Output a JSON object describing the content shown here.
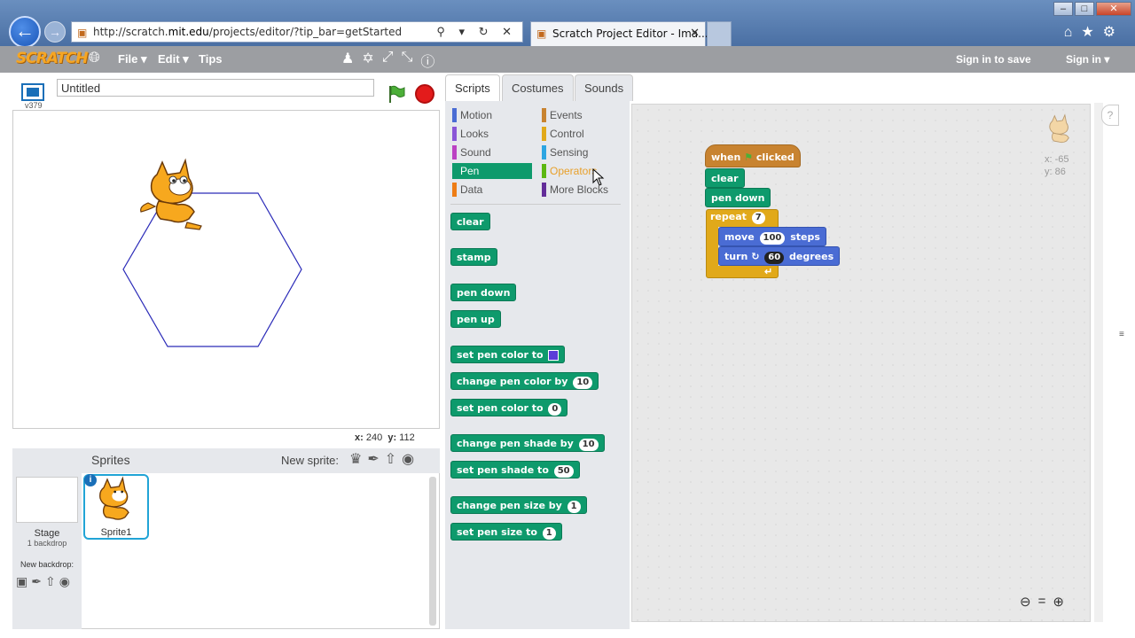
{
  "browser": {
    "url_prefix": "http://scratch.",
    "url_domain": "mit.edu",
    "url_path": "/projects/editor/?tip_bar=getStarted",
    "tab_title": "Scratch Project Editor - Ima...",
    "tab_close": "✕",
    "addr_tools": "⚲ ▾ ↻ ✕",
    "back_icon": "arrow-left",
    "forward_icon": "arrow-right"
  },
  "menu": {
    "logo": "SCRATCH",
    "file": "File ▾",
    "edit": "Edit ▾",
    "tips": "Tips",
    "sign_in_save": "Sign in to save",
    "sign_in": "Sign in ▾"
  },
  "stage": {
    "version": "v379",
    "project_title": "Untitled",
    "coords_x_label": "x:",
    "coords_x": "240",
    "coords_y_label": "y:",
    "coords_y": "112"
  },
  "sprites": {
    "header": "Sprites",
    "new_sprite_label": "New sprite:",
    "stage_label": "Stage",
    "stage_backdrops": "1 backdrop",
    "new_backdrop_label": "New backdrop:",
    "sprite_name": "Sprite1"
  },
  "tabs": {
    "scripts": "Scripts",
    "costumes": "Costumes",
    "sounds": "Sounds"
  },
  "categories": {
    "motion": "Motion",
    "looks": "Looks",
    "sound": "Sound",
    "pen": "Pen",
    "data": "Data",
    "events": "Events",
    "control": "Control",
    "sensing": "Sensing",
    "operators": "Operators",
    "more_blocks": "More Blocks"
  },
  "palette": {
    "clear": "clear",
    "stamp": "stamp",
    "pen_down": "pen down",
    "pen_up": "pen up",
    "set_pen_color_to": "set pen color to",
    "change_pen_color_by": "change pen color by",
    "change_pen_color_by_val": "10",
    "set_pen_color_to_num": "set pen color to",
    "set_pen_color_to_num_val": "0",
    "change_pen_shade_by": "change pen shade by",
    "change_pen_shade_by_val": "10",
    "set_pen_shade_to": "set pen shade to",
    "set_pen_shade_to_val": "50",
    "change_pen_size_by": "change pen size by",
    "change_pen_size_by_val": "1",
    "set_pen_size_to": "set pen size to",
    "set_pen_size_to_val": "1"
  },
  "script": {
    "when": "when",
    "clicked": "clicked",
    "clear": "clear",
    "pen_down": "pen down",
    "repeat": "repeat",
    "repeat_val": "7",
    "move": "move",
    "move_val": "100",
    "steps": "steps",
    "turn": "turn",
    "turn_val": "60",
    "degrees": "degrees"
  },
  "sprite_info": {
    "x_label": "x:",
    "x": "-65",
    "y_label": "y:",
    "y": "86"
  },
  "colors": {
    "pen": "#0e9a6c",
    "events": "#c88330",
    "control": "#e1a91a",
    "motion": "#4a6cd4",
    "menu_bar": "#9c9ea2"
  }
}
